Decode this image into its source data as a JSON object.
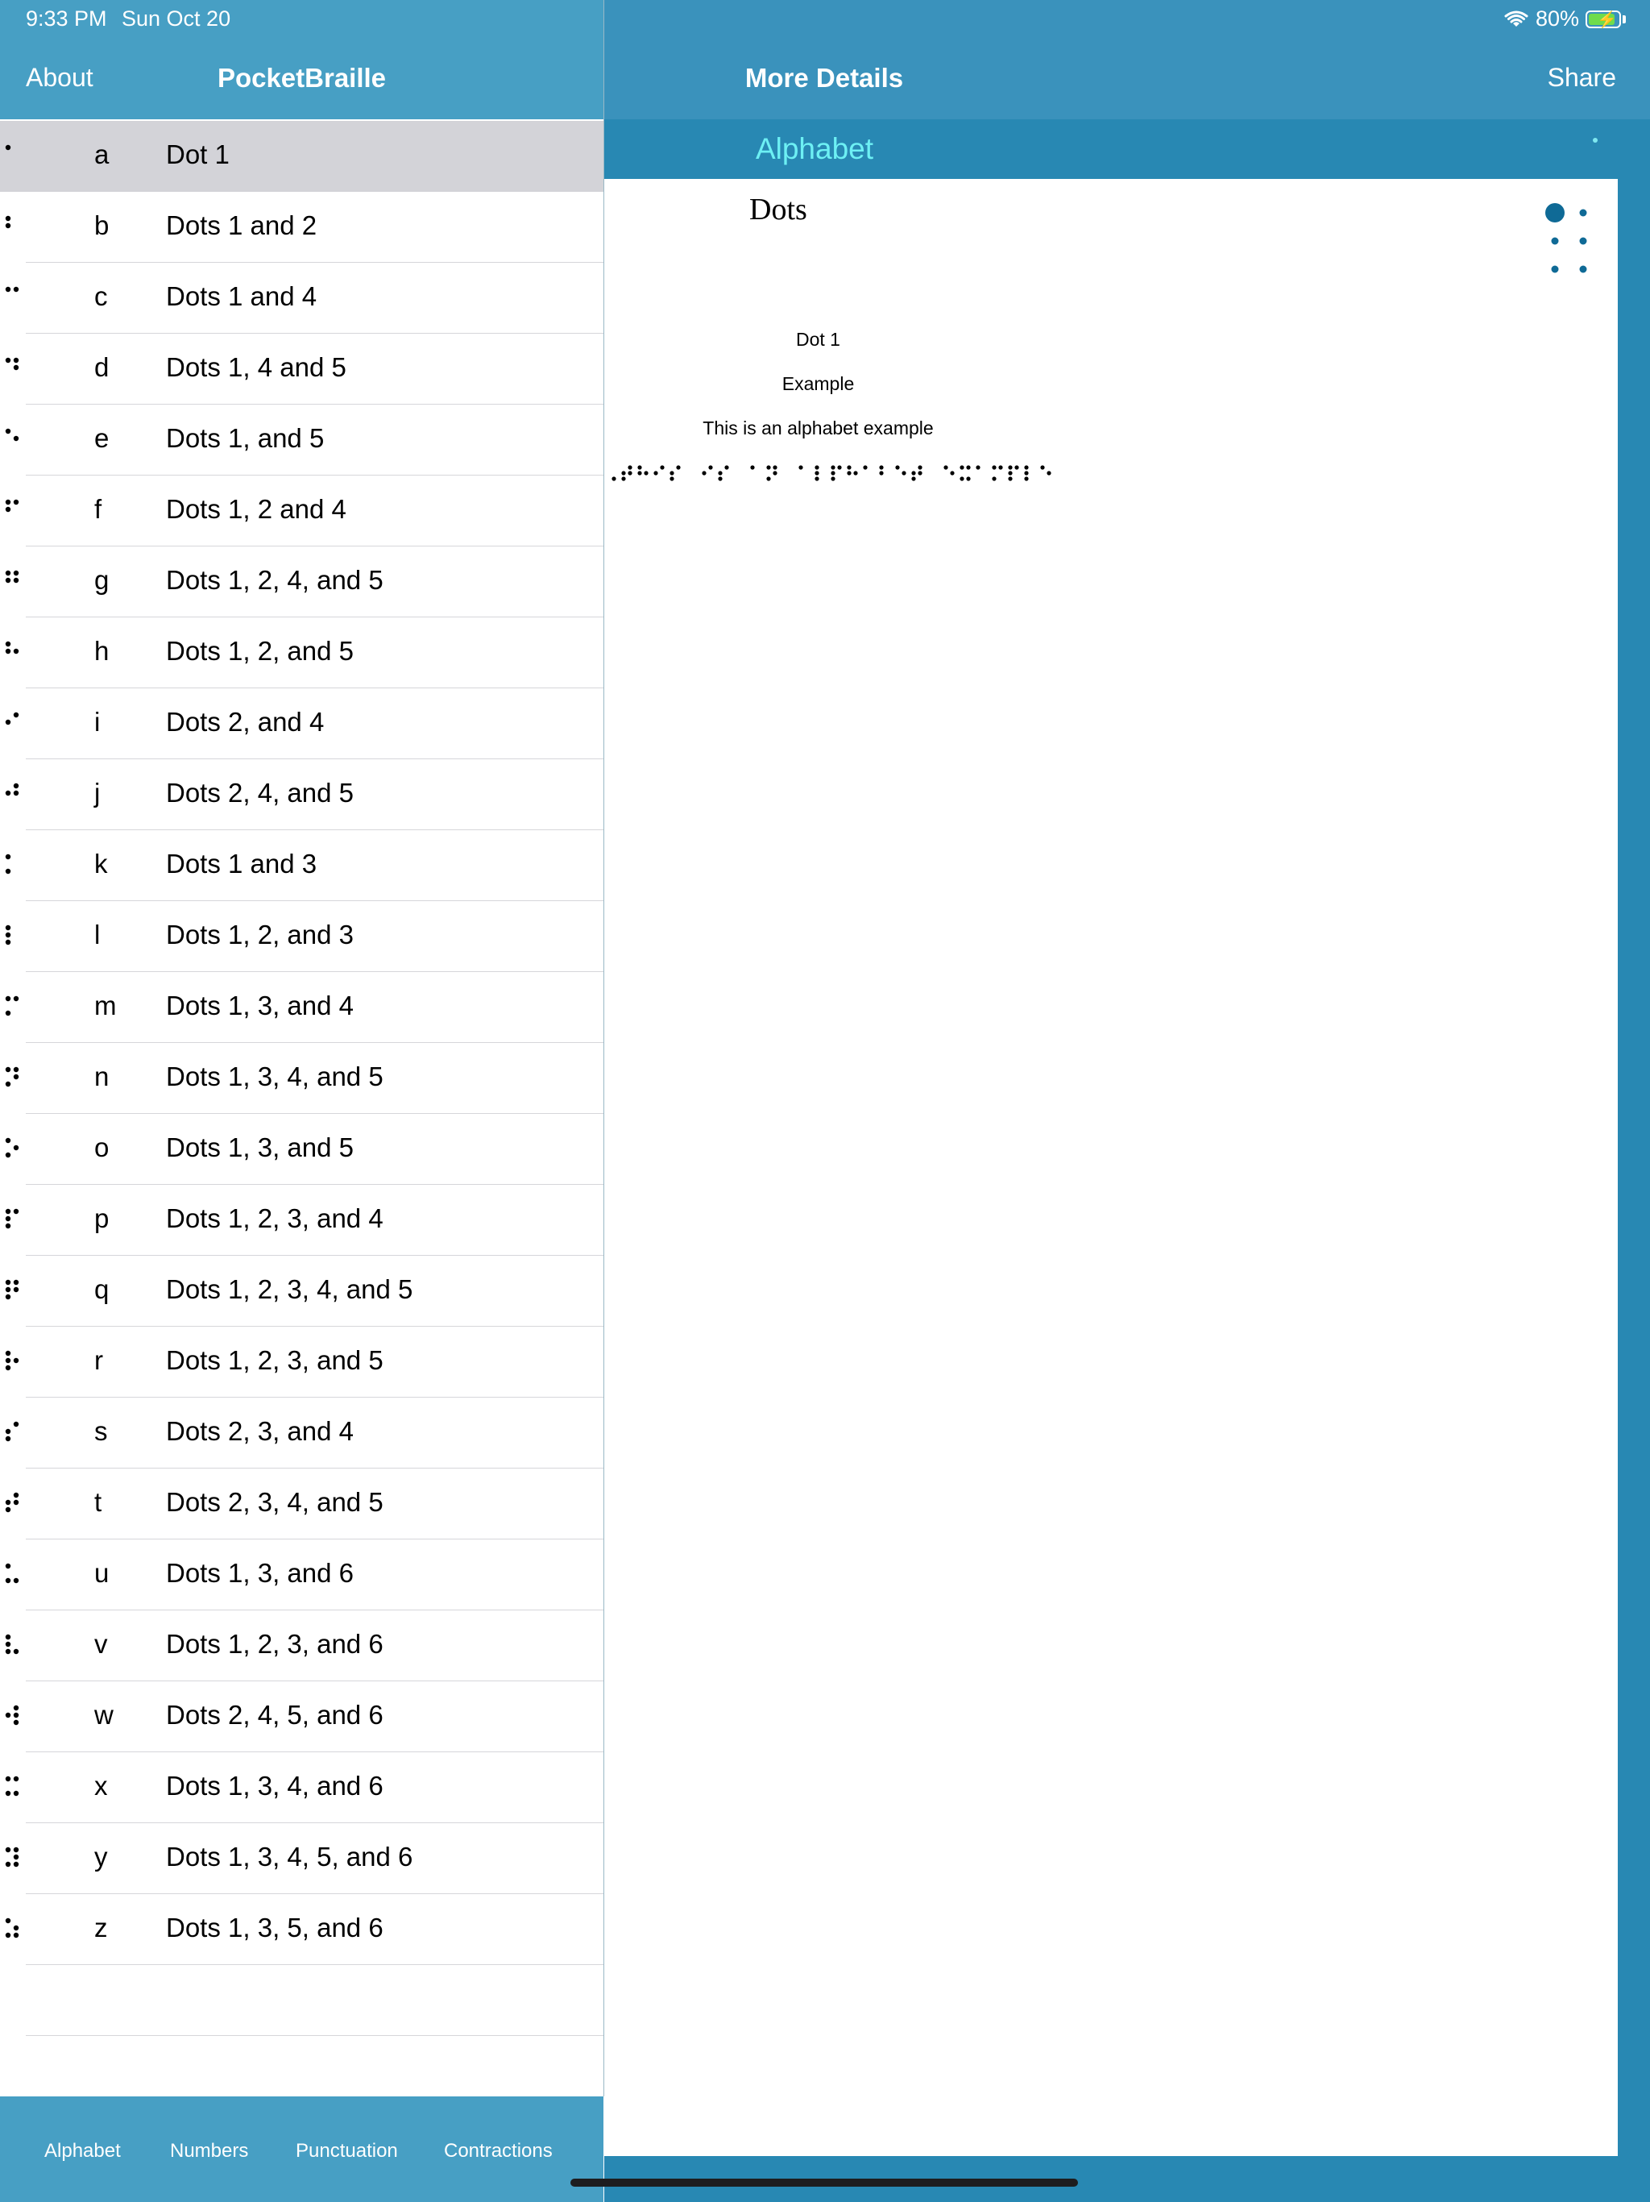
{
  "status_bar": {
    "time": "9:33 PM",
    "date": "Sun Oct 20",
    "battery": "80%",
    "battery_level": 0.8,
    "wifi_icon": "wifi-icon"
  },
  "left_header": {
    "about": "About",
    "title": "PocketBraille"
  },
  "list": [
    {
      "letter": "a",
      "desc": "Dot 1",
      "dots": [
        1
      ],
      "selected": true
    },
    {
      "letter": "b",
      "desc": "Dots 1 and 2",
      "dots": [
        1,
        2
      ]
    },
    {
      "letter": "c",
      "desc": "Dots 1 and 4",
      "dots": [
        1,
        4
      ]
    },
    {
      "letter": "d",
      "desc": "Dots 1, 4 and 5",
      "dots": [
        1,
        4,
        5
      ]
    },
    {
      "letter": "e",
      "desc": "Dots 1, and 5",
      "dots": [
        1,
        5
      ]
    },
    {
      "letter": "f",
      "desc": "Dots 1, 2 and 4",
      "dots": [
        1,
        2,
        4
      ]
    },
    {
      "letter": "g",
      "desc": "Dots 1, 2, 4, and 5",
      "dots": [
        1,
        2,
        4,
        5
      ]
    },
    {
      "letter": "h",
      "desc": "Dots 1, 2, and 5",
      "dots": [
        1,
        2,
        5
      ]
    },
    {
      "letter": "i",
      "desc": "Dots 2, and 4",
      "dots": [
        2,
        4
      ]
    },
    {
      "letter": "j",
      "desc": "Dots 2, 4, and 5",
      "dots": [
        2,
        4,
        5
      ]
    },
    {
      "letter": "k",
      "desc": "Dots 1 and 3",
      "dots": [
        1,
        3
      ]
    },
    {
      "letter": "l",
      "desc": "Dots 1, 2, and 3",
      "dots": [
        1,
        2,
        3
      ]
    },
    {
      "letter": "m",
      "desc": "Dots 1, 3, and 4",
      "dots": [
        1,
        3,
        4
      ]
    },
    {
      "letter": "n",
      "desc": "Dots 1, 3, 4, and 5",
      "dots": [
        1,
        3,
        4,
        5
      ]
    },
    {
      "letter": "o",
      "desc": "Dots 1, 3, and 5",
      "dots": [
        1,
        3,
        5
      ]
    },
    {
      "letter": "p",
      "desc": "Dots 1, 2, 3, and 4",
      "dots": [
        1,
        2,
        3,
        4
      ]
    },
    {
      "letter": "q",
      "desc": "Dots 1, 2, 3, 4, and 5",
      "dots": [
        1,
        2,
        3,
        4,
        5
      ]
    },
    {
      "letter": "r",
      "desc": "Dots 1, 2, 3, and 5",
      "dots": [
        1,
        2,
        3,
        5
      ]
    },
    {
      "letter": "s",
      "desc": "Dots 2, 3, and 4",
      "dots": [
        2,
        3,
        4
      ]
    },
    {
      "letter": "t",
      "desc": "Dots 2, 3, 4, and 5",
      "dots": [
        2,
        3,
        4,
        5
      ]
    },
    {
      "letter": "u",
      "desc": "Dots 1, 3, and 6",
      "dots": [
        1,
        3,
        6
      ]
    },
    {
      "letter": "v",
      "desc": "Dots 1, 2, 3, and 6",
      "dots": [
        1,
        2,
        3,
        6
      ]
    },
    {
      "letter": "w",
      "desc": "Dots 2, 4, 5, and 6",
      "dots": [
        2,
        4,
        5,
        6
      ]
    },
    {
      "letter": "x",
      "desc": "Dots 1, 3, 4, and 6",
      "dots": [
        1,
        3,
        4,
        6
      ]
    },
    {
      "letter": "y",
      "desc": "Dots 1, 3, 4, 5, and 6",
      "dots": [
        1,
        3,
        4,
        5,
        6
      ]
    },
    {
      "letter": "z",
      "desc": "Dots 1, 3, 5, and 6",
      "dots": [
        1,
        3,
        5,
        6
      ]
    }
  ],
  "tabs": [
    "Alphabet",
    "Numbers",
    "Punctuation",
    "Contractions"
  ],
  "right_header": {
    "title": "More Details",
    "share": "Share"
  },
  "detail": {
    "section": "Alphabet",
    "heading": "Dots",
    "cell_dots": [
      1
    ],
    "dot_label": "Dot 1",
    "example_label": "Example",
    "example_text": "This is an alphabet example",
    "braille_example": "⠠⠞⠓⠊⠎ ⠊⠎ ⠁⠝ ⠁⠇⠏⠓⠁⠃⠑⠞ ⠑⠭⠁⠍⠏⠇⠑"
  },
  "colors": {
    "header": "#479fc4",
    "right_bg": "#2888b3",
    "accent": "#6df0f4",
    "big_dot": "#0f6a96"
  }
}
